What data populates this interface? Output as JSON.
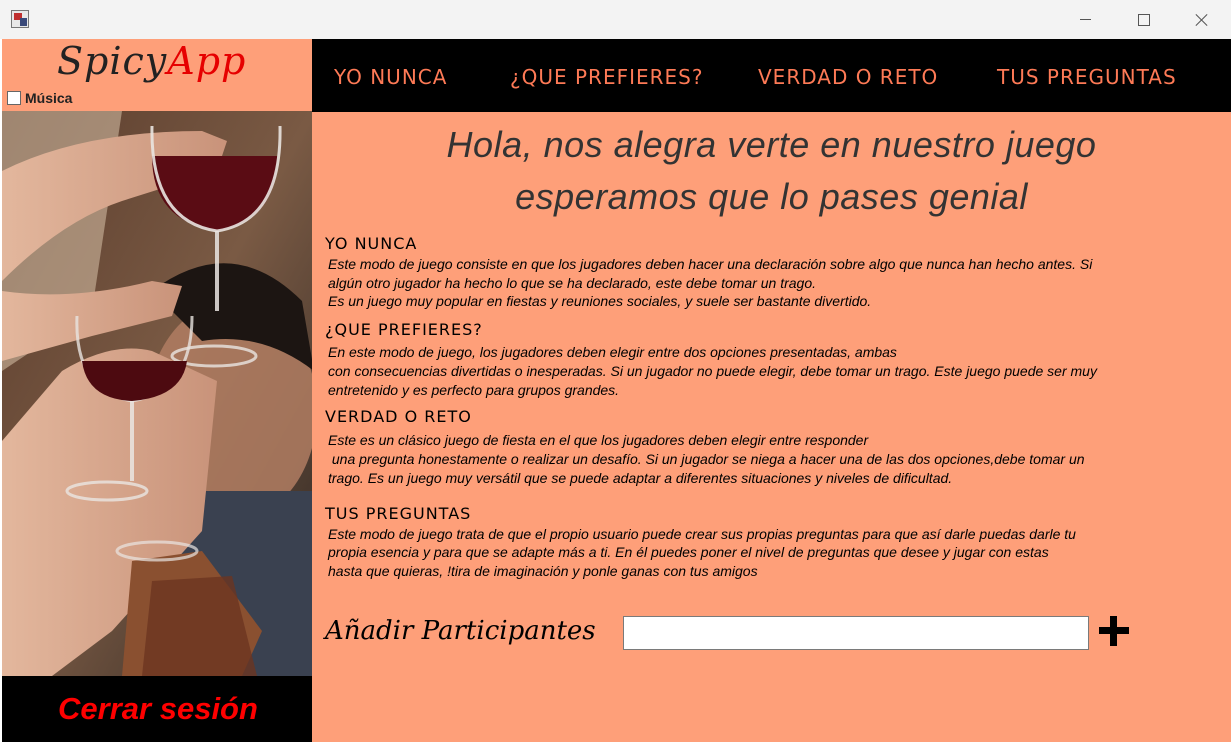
{
  "window": {
    "app_icon": "java-app-icon"
  },
  "sidebar": {
    "logo": {
      "part1": "Spicy",
      "part2": "App"
    },
    "music_label": "Música",
    "logout_label": "Cerrar sesión"
  },
  "nav": {
    "items": [
      {
        "label": "YO NUNCA"
      },
      {
        "label": "¿QUE PREFIERES?"
      },
      {
        "label": "VERDAD O RETO"
      },
      {
        "label": "TUS PREGUNTAS"
      }
    ]
  },
  "main": {
    "welcome": [
      "Hola, nos alegra verte en nuestro juego",
      "esperamos que lo pases genial"
    ],
    "sections": [
      {
        "title": "YO NUNCA",
        "lines": [
          "Este modo de juego consiste en que los jugadores deben hacer una declaración sobre algo que nunca han hecho antes. Si",
          "algún otro jugador ha hecho lo que se ha declarado, este debe tomar un trago.",
          "Es un juego muy popular en fiestas y reuniones sociales, y suele ser bastante divertido."
        ]
      },
      {
        "title": "¿QUE PREFIERES?",
        "lines": [
          "En este modo de juego, los jugadores deben elegir entre dos opciones presentadas, ambas",
          "con consecuencias divertidas o inesperadas. Si un jugador no puede elegir, debe tomar un trago. Este juego puede ser muy",
          "entretenido y es perfecto para grupos grandes."
        ]
      },
      {
        "title": "VERDAD O RETO",
        "lines": [
          "Este es un clásico juego de fiesta en el que los jugadores deben elegir entre responder",
          " una pregunta honestamente o realizar un desafío. Si un jugador se niega a hacer una de las dos opciones,debe tomar un",
          "trago. Es un juego muy versátil que se puede adaptar a diferentes situaciones y niveles de dificultad."
        ]
      },
      {
        "title": "TUS PREGUNTAS",
        "lines": [
          "Este modo de juego trata de que el propio usuario puede crear sus propias preguntas para que así darle puedas darle tu",
          "propia esencia y para que se adapte más a ti. En él puedes poner el nivel de preguntas que desee y jugar con estas",
          "hasta que quieras, !tira de imaginación y ponle ganas con tus amigos"
        ]
      }
    ],
    "add_participants": {
      "label": "Añadir Participantes",
      "input_value": "",
      "button_icon": "plus-icon"
    }
  },
  "colors": {
    "background": "#fe9f79",
    "nav_background": "#000000",
    "nav_text": "#fe7a56",
    "logo_accent": "#e60000",
    "logout_text": "#ff0000"
  }
}
